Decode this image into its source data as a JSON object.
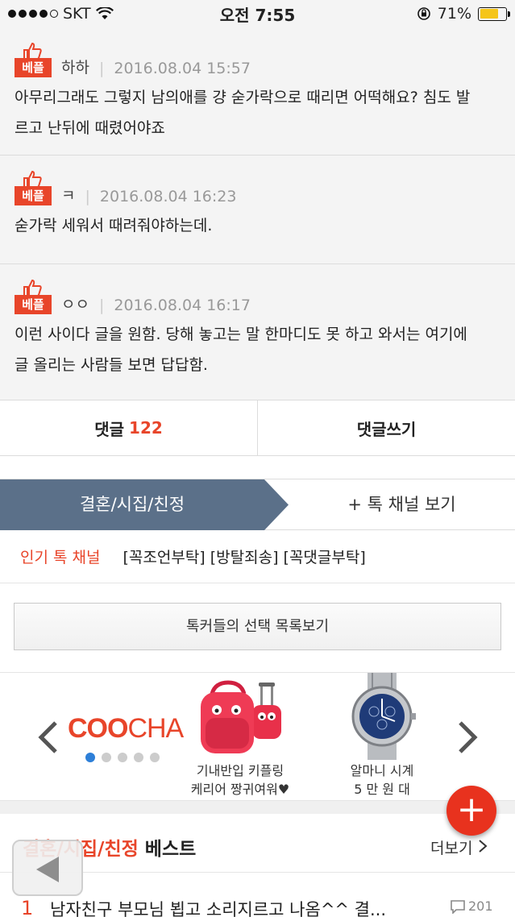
{
  "status_bar": {
    "carrier": "SKT",
    "time": "오전 7:55",
    "battery": "71%",
    "battery_level": 0.71
  },
  "comments": [
    {
      "badge": "베플",
      "author": "하하",
      "date": "2016.08.04 15:57",
      "text_lines": [
        "아무리그래도 그렇지 남의애를 걍 숟가락으로 때리면 어떡해요? 침도 발",
        "르고 난뒤에 때렸어야죠"
      ]
    },
    {
      "badge": "베플",
      "author": "ㅋ",
      "date": "2016.08.04 16:23",
      "text_lines": [
        "숟가락 세워서 때려줘야하는데."
      ]
    },
    {
      "badge": "베플",
      "author": "ㅇㅇ",
      "date": "2016.08.04 16:17",
      "text_lines": [
        "이런 사이다 글을 원함. 당해 놓고는 말 한마디도 못 하고 와서는 여기에",
        "글 올리는 사람들 보면 답답함."
      ]
    }
  ],
  "comment_bar": {
    "comments_label": "댓글",
    "comments_count": "122",
    "write_label": "댓글쓰기"
  },
  "channel": {
    "current": "결혼/시집/친정",
    "more": "+ 톡 채널 보기"
  },
  "popular": {
    "label": "인기 톡 채널",
    "tags": "[꼭조언부탁] [방탈죄송] [꼭댓글부탁]"
  },
  "picks_button": "톡커들의 선택 목록보기",
  "ad": {
    "brand_bold": "COO",
    "brand_light": "CHA",
    "products": [
      {
        "caption_lines": [
          "기내반입 키플링",
          "케리어 짱귀여워♥"
        ]
      },
      {
        "caption_lines": [
          "알마니 시계",
          "5 만 원 대"
        ]
      }
    ],
    "colors": {
      "accent": "#e8452a",
      "dot_active": "#2d7fd8"
    }
  },
  "best": {
    "title_red": "결혼/시집/친정",
    "title_dark": "베스트",
    "more": "더보기",
    "items": [
      {
        "rank": "1",
        "title": "남자친구 부모님 뵙고 소리지르고 나옴^^ 결...",
        "comments": "201"
      }
    ]
  },
  "fab_label": "+"
}
